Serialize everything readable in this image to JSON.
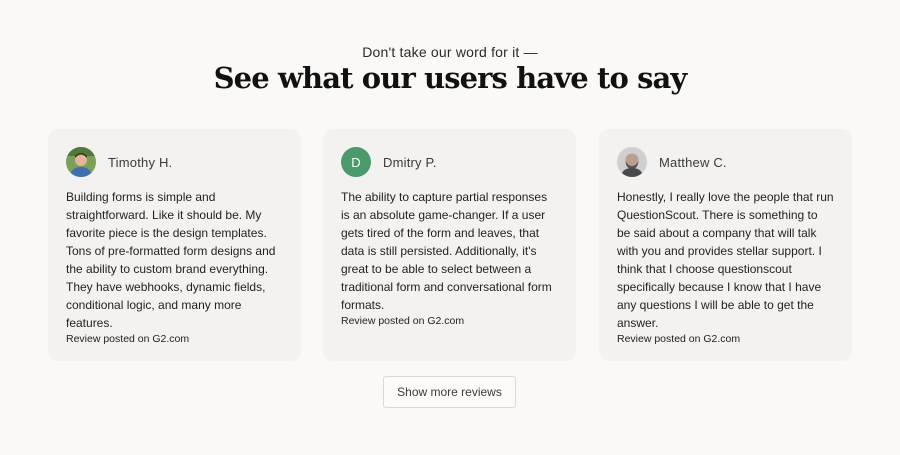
{
  "section": {
    "kicker": "Don't take our word for it —",
    "title": "See what our users have to say"
  },
  "reviews": [
    {
      "name": "Timothy H.",
      "avatar": "photo-avatar",
      "text": "Building forms is simple and straightforward. Like it should be. My favorite piece is the design templates. Tons of pre-formatted form designs and the ability to custom brand everything. They have webhooks, dynamic fields, conditional logic, and many more features.",
      "source": "Review posted on G2.com"
    },
    {
      "name": "Dmitry P.",
      "avatar_initial": "D",
      "avatar_color": "#4a9a6b",
      "text": "The ability to capture partial responses is an absolute game-changer. If a user gets tired of the form and leaves, that data is still persisted. Additionally, it's great to be able to select between a traditional form and conversational form formats.",
      "source": "Review posted on G2.com"
    },
    {
      "name": "Matthew C.",
      "avatar": "photo-avatar",
      "text": "Honestly, I really love the people that run QuestionScout. There is something to be said about a company that will talk with you and provides stellar support. I think that I choose questionscout specifically because I know that I have any questions I will be able to get the answer.",
      "source": "Review posted on G2.com"
    }
  ],
  "actions": {
    "show_more_label": "Show more reviews"
  }
}
